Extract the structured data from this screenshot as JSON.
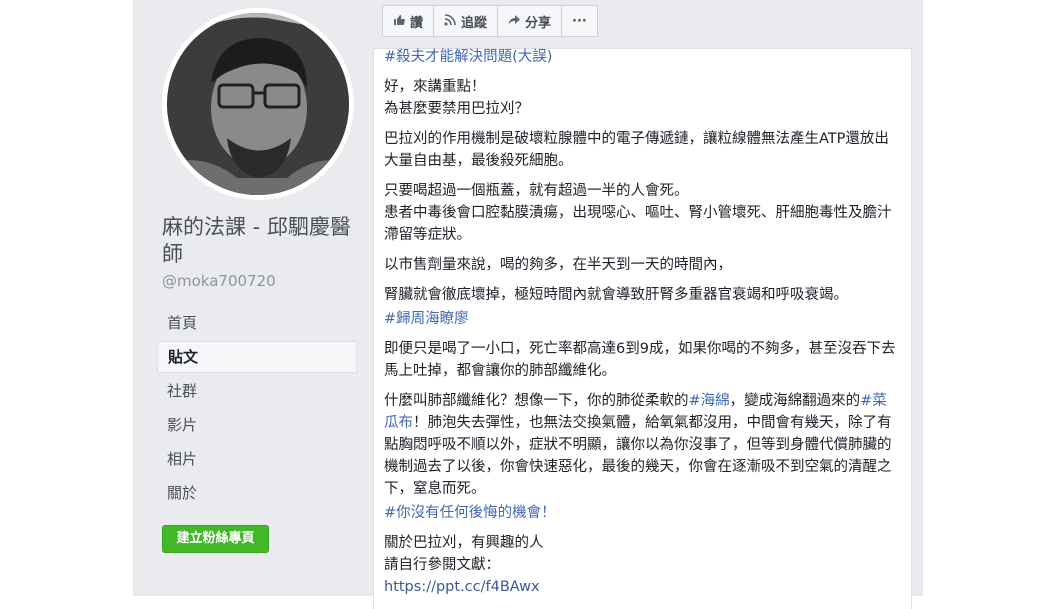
{
  "page": {
    "name": "麻的法課 - 邱駟慶醫師",
    "handle": "@moka700720"
  },
  "nav": [
    "首頁",
    "貼文",
    "社群",
    "影片",
    "相片",
    "關於"
  ],
  "fan_button": "建立粉絲專頁",
  "actions": {
    "like": "讚",
    "follow": "追蹤",
    "share": "分享",
    "more": "···"
  },
  "post": {
    "l0": "#殺夫才能解決問題(大誤)",
    "l1": "好，來講重點！",
    "l2": "為甚麼要禁用巴拉刈？",
    "l3": "巴拉刈的作用機制是破壞粒腺體中的電子傳遞鏈，讓粒線體無法產生ATP還放出大量自由基，最後殺死細胞。",
    "l4": "只要喝超過一個瓶蓋，就有超過一半的人會死。",
    "l5": "患者中毒後會口腔黏膜潰瘍，出現噁心、嘔吐、腎小管壞死、肝細胞毒性及膽汁滯留等症狀。",
    "l6": "以市售劑量來說，喝的夠多，在半天到一天的時間內，",
    "l7": "腎臟就會徹底壞掉，極短時間內就會導致肝腎多重器官衰竭和呼吸衰竭。",
    "l8": "#歸周海瞭廖",
    "l9": "即便只是喝了一小口，死亡率都高達6到9成，如果你喝的不夠多，甚至沒吞下去馬上吐掉，都會讓你的肺部纖維化。",
    "l10a": "什麼叫肺部纖維化？想像一下，你的肺從柔軟的",
    "l10tag1": "#海綿",
    "l10b": "，變成海綿翻過來的",
    "l10tag2": "#菜瓜布",
    "l10c": "！肺泡失去彈性，也無法交換氣體，給氧氣都沒用，中間會有幾天，除了有點胸悶呼吸不順以外，症狀不明顯，讓你以為你沒事了，但等到身體代償肺臟的機制過去了以後，你會快速惡化，最後的幾天，你會在逐漸吸不到空氣的清醒之下，窒息而死。",
    "l11": "#你沒有任何後悔的機會！",
    "l12": "關於巴拉刈，有興趣的人",
    "l13": "請自行參閱文獻：",
    "l14": "https://ppt.cc/f4BAwx"
  }
}
